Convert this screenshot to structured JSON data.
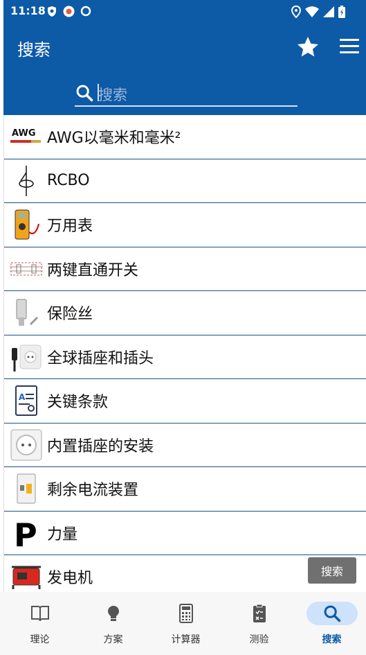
{
  "status": {
    "time": "11:18"
  },
  "appbar": {
    "title": "搜索",
    "star_icon": "star-icon",
    "menu_icon": "menu-icon"
  },
  "search": {
    "placeholder": "搜索",
    "icon": "search-icon"
  },
  "list": {
    "items": [
      {
        "label": "AWG以毫米和毫米²",
        "icon": "awg-wire-icon"
      },
      {
        "label": "RCBO",
        "icon": "rcbo-symbol-icon"
      },
      {
        "label": "万用表",
        "icon": "multimeter-icon"
      },
      {
        "label": "两键直通开关",
        "icon": "switch-wiring-icon"
      },
      {
        "label": "保险丝",
        "icon": "fuse-icon"
      },
      {
        "label": "全球插座和插头",
        "icon": "plug-socket-icon"
      },
      {
        "label": "关键条款",
        "icon": "glossary-book-icon"
      },
      {
        "label": "内置插座的安装",
        "icon": "wall-socket-icon"
      },
      {
        "label": "剩余电流装置",
        "icon": "rcd-device-icon"
      },
      {
        "label": "力量",
        "icon": "power-p-icon"
      },
      {
        "label": "发电机",
        "icon": "generator-icon"
      }
    ]
  },
  "tooltip": {
    "text": "搜索"
  },
  "bottomnav": {
    "items": [
      {
        "label": "理论",
        "icon": "book-icon"
      },
      {
        "label": "方案",
        "icon": "lightbulb-icon"
      },
      {
        "label": "计算器",
        "icon": "calculator-icon"
      },
      {
        "label": "测验",
        "icon": "clipboard-icon"
      },
      {
        "label": "搜索",
        "icon": "search-icon",
        "active": true
      }
    ]
  },
  "colors": {
    "primary": "#0d5aa7",
    "active_pill": "#cfe2fb",
    "divider": "#1b4f8a"
  }
}
